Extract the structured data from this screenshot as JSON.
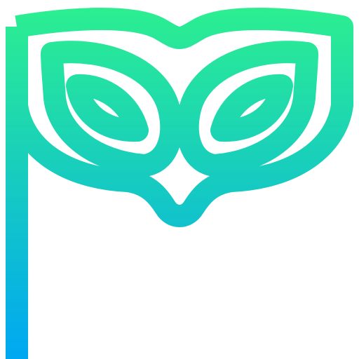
{
  "icon": {
    "name": "masquerade-mask-on-stick-icon",
    "gradient": {
      "top_color": "#2df08e",
      "bottom_color": "#00a7f2"
    },
    "background": "#ffffff"
  }
}
